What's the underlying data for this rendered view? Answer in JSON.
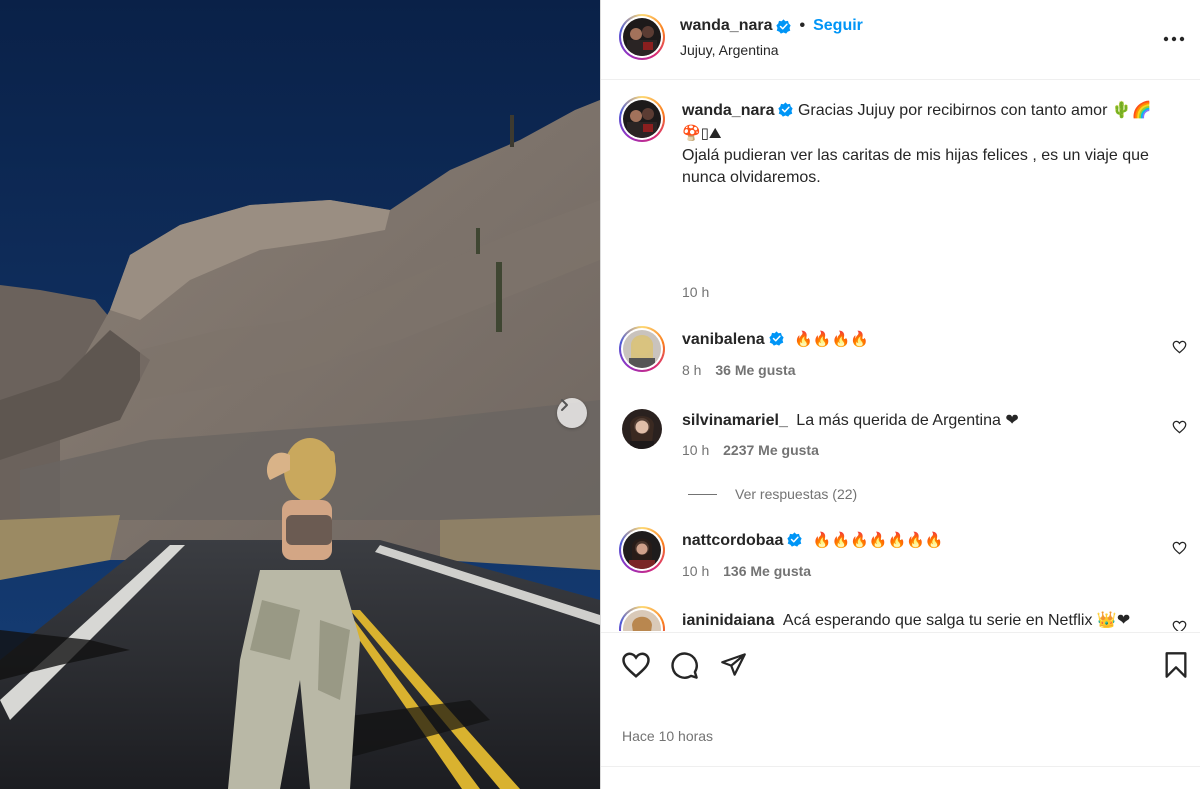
{
  "post": {
    "author": "wanda_nara",
    "follow_label": "Seguir",
    "separator": "•",
    "location": "Jujuy, Argentina",
    "caption_line1": "Gracias Jujuy por recibirnos con tanto amor 🌵🌈",
    "caption_line2": "🍄▯⛰",
    "caption_line3": "Ojalá pudieran ver las caritas de mis hijas felices , es un viaje que nunca olvidaremos.",
    "caption_time": "10 h",
    "posted_ago": "Hace 10 horas"
  },
  "comments": [
    {
      "user": "vanibalena",
      "verified": true,
      "text": "🔥🔥🔥🔥",
      "time": "8 h",
      "likes": "36 Me gusta"
    },
    {
      "user": "silvinamariel_",
      "verified": false,
      "text": "La más querida de Argentina ❤",
      "time": "10 h",
      "likes": "2237 Me gusta"
    },
    {
      "user": "nattcordobaa",
      "verified": true,
      "text": "🔥🔥🔥🔥🔥🔥🔥",
      "time": "10 h",
      "likes": "136 Me gusta"
    },
    {
      "user": "ianinidaiana",
      "verified": false,
      "text": "Acá esperando que salga tu serie en Netflix 👑❤",
      "time": "",
      "likes": ""
    }
  ],
  "view_replies": "Ver respuestas (22)",
  "icons": {
    "like": "heart-icon",
    "comment": "comment-icon",
    "share": "share-icon",
    "save": "bookmark-icon",
    "more": "more-options-icon",
    "next": "chevron-right-icon",
    "verified": "verified-badge-icon"
  },
  "colors": {
    "accent": "#0095f6",
    "verified": "#0095f6",
    "muted": "#737373",
    "text": "#262626"
  }
}
